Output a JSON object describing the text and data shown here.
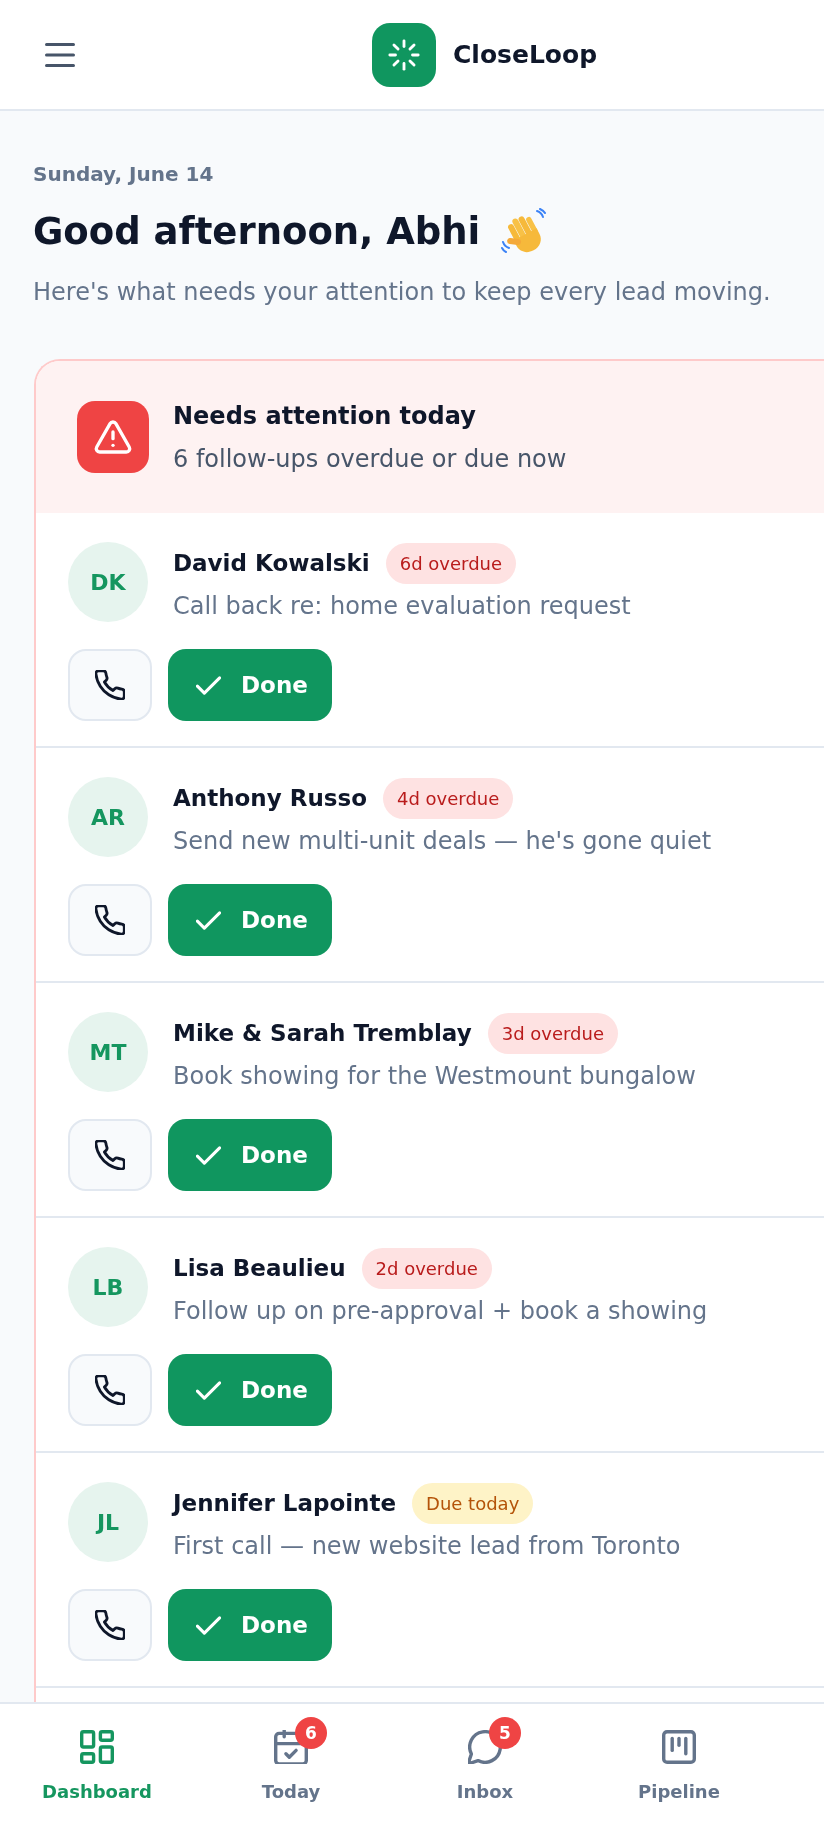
{
  "header": {
    "brand": "CloseLoop"
  },
  "greeting": {
    "date": "Sunday, June 14",
    "title": "Good afternoon, Abhi",
    "subtitle": "Here's what needs your attention to keep every lead moving."
  },
  "attention": {
    "title": "Needs attention today",
    "subtitle": "6 follow-ups overdue or due now",
    "items": [
      {
        "initials": "DK",
        "name": "David Kowalski",
        "status": {
          "kind": "overdue",
          "text": "6d overdue"
        },
        "task": "Call back re: home evaluation request",
        "action": "Done"
      },
      {
        "initials": "AR",
        "name": "Anthony Russo",
        "status": {
          "kind": "overdue",
          "text": "4d overdue"
        },
        "task": "Send new multi-unit deals — he's gone quiet",
        "action": "Done"
      },
      {
        "initials": "MT",
        "name": "Mike & Sarah Tremblay",
        "status": {
          "kind": "overdue",
          "text": "3d overdue"
        },
        "task": "Book showing for the Westmount bungalow",
        "action": "Done"
      },
      {
        "initials": "LB",
        "name": "Lisa Beaulieu",
        "status": {
          "kind": "overdue",
          "text": "2d overdue"
        },
        "task": "Follow up on pre-approval + book a showing",
        "action": "Done"
      },
      {
        "initials": "JL",
        "name": "Jennifer Lapointe",
        "status": {
          "kind": "due",
          "text": "Due today"
        },
        "task": "First call — new website lead from Toronto",
        "action": "Done"
      }
    ]
  },
  "bottom_nav": [
    {
      "label": "Dashboard",
      "selected": true
    },
    {
      "label": "Today",
      "selected": false,
      "badge": "6"
    },
    {
      "label": "Inbox",
      "selected": false,
      "badge": "5"
    },
    {
      "label": "Pipeline",
      "selected": false
    }
  ]
}
